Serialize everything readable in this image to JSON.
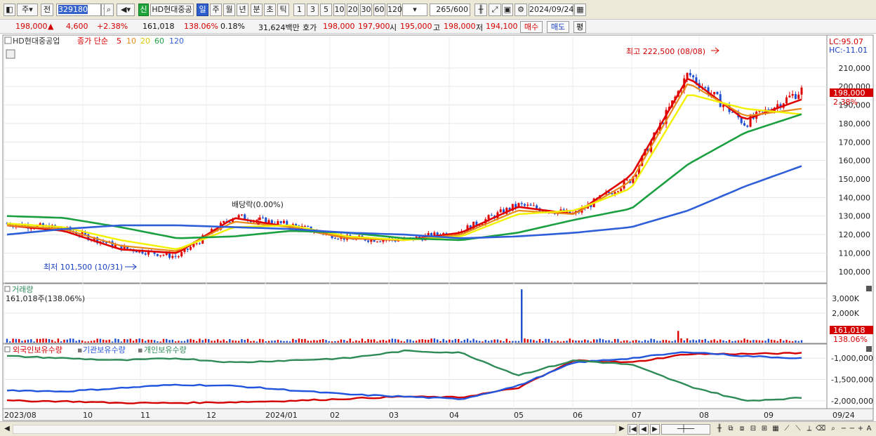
{
  "toolbar": {
    "period_main": "주",
    "view_mode": "전",
    "stock_code": "329180",
    "sin_label": "신",
    "stock_name": "HD현대중공",
    "periods": [
      "일",
      "주",
      "월",
      "년",
      "분",
      "초",
      "틱"
    ],
    "active_period": "일",
    "intervals": [
      "1",
      "3",
      "5",
      "10",
      "20",
      "30",
      "60",
      "120"
    ],
    "count_display": "265",
    "count_total": "/600",
    "date_value": "2024/09/24"
  },
  "quote": {
    "price": "198,000",
    "change": "4,600",
    "change_pct": "+2.38%",
    "volume": "161,018",
    "volume_ratio": "138.06%",
    "turnover_rate": "0.18%",
    "trade_value": "31,624백만",
    "hoga_label": "호가",
    "ask": "198,000",
    "bid": "197,900",
    "open_label": "시",
    "open": "195,000",
    "high_label": "고",
    "high": "198,000",
    "low_label": "저",
    "low": "194,100",
    "buy_label": "매수",
    "sell_label": "매도",
    "eval_label": "평"
  },
  "price_panel": {
    "legend_name": "HD현대중공업",
    "legend_ma_label": "종가 단순",
    "ma_periods": [
      "5",
      "10",
      "20",
      "60",
      "120"
    ],
    "ma_colors": [
      "#e00000",
      "#e88a1a",
      "#f2f200",
      "#1aa040",
      "#2e5fd8"
    ],
    "lc_label": "LC:95.07",
    "hc_label": "HC:-11.01",
    "high_annotation": "최고 222,500 (08/08)",
    "low_annotation": "최저 101,500 (10/31)",
    "dividend_annotation": "배당락(0.00%)",
    "current_price_tag": "198,000",
    "current_pct_tag": "2.38%"
  },
  "volume_panel": {
    "title": "거래량",
    "value_label": "161,018주(138.06%)",
    "tag_value": "161,018",
    "tag_pct": "138.06%"
  },
  "holding_panel": {
    "labels": [
      "외국인보유수량",
      "기관보유수량",
      "개인보유수량"
    ],
    "colors": [
      "#d40000",
      "#2255dd",
      "#2e8b57"
    ]
  },
  "axis": {
    "date_ticks": [
      "2023/08",
      "10",
      "11",
      "12",
      "2024/01",
      "02",
      "03",
      "04",
      "05",
      "06",
      "07",
      "08",
      "09"
    ],
    "last_date": "09/24"
  },
  "chart_data": [
    {
      "type": "candlestick",
      "title": "HD현대중공업",
      "y_ticks": [
        "100,000",
        "110,000",
        "120,000",
        "130,000",
        "140,000",
        "150,000",
        "160,000",
        "170,000",
        "180,000",
        "190,000",
        "200,000",
        "210,000"
      ],
      "ylim": [
        95000,
        227000
      ],
      "x_months": [
        "2023/08",
        "09",
        "10",
        "11",
        "12",
        "2024/01",
        "02",
        "03",
        "04",
        "05",
        "06",
        "07",
        "08",
        "09"
      ],
      "close_monthly": [
        126000,
        123000,
        113000,
        108000,
        130000,
        125000,
        118000,
        117000,
        122000,
        136000,
        131000,
        150000,
        207000,
        180000,
        198000
      ],
      "series": [
        {
          "name": "5",
          "values": [
            125000,
            122000,
            112000,
            110000,
            129000,
            124000,
            118000,
            117000,
            121000,
            135000,
            131000,
            152000,
            205000,
            182000,
            193000
          ]
        },
        {
          "name": "10",
          "values": [
            125000,
            123000,
            114000,
            111000,
            127000,
            124000,
            118000,
            117000,
            120000,
            133000,
            131000,
            149000,
            202000,
            184000,
            188000
          ]
        },
        {
          "name": "20",
          "values": [
            126000,
            124000,
            117000,
            112000,
            124000,
            125000,
            119000,
            117000,
            119000,
            131000,
            133000,
            145000,
            196000,
            188000,
            185000
          ]
        },
        {
          "name": "60",
          "values": [
            130000,
            129000,
            124000,
            118000,
            119000,
            122000,
            121000,
            118000,
            117000,
            121000,
            128000,
            134000,
            158000,
            175000,
            185000
          ]
        },
        {
          "name": "120",
          "values": [
            120000,
            123000,
            125000,
            125000,
            124000,
            123000,
            121000,
            120000,
            118000,
            119000,
            121000,
            124000,
            133000,
            146000,
            157000
          ]
        }
      ],
      "annotations": {
        "high": 222500,
        "low": 101500,
        "current": 198000
      }
    },
    {
      "type": "bar",
      "title": "거래량",
      "y_ticks": [
        "2,000K",
        "3,000K"
      ],
      "ylim": [
        0,
        3700000
      ],
      "spike": 3600000,
      "typical": 180000,
      "last": 161018
    },
    {
      "type": "line",
      "y_ticks": [
        "-1,000,000",
        "-1,500,000",
        "-2,000,000"
      ],
      "ylim": [
        -2150000,
        -700000
      ],
      "series": [
        {
          "name": "외국인보유수량",
          "values": [
            -2000000,
            -2010000,
            -2050000,
            -2050000,
            -2030000,
            -2000000,
            -1950000,
            -1900000,
            -1920000,
            -1700000,
            -1050000,
            -1100000,
            -900000,
            -900000,
            -880000
          ]
        },
        {
          "name": "기관보유수량",
          "values": [
            -1750000,
            -1780000,
            -1700000,
            -1620000,
            -1650000,
            -1750000,
            -1850000,
            -1900000,
            -1960000,
            -1650000,
            -1100000,
            -1000000,
            -850000,
            -950000,
            -1000000
          ]
        },
        {
          "name": "개인보유수량",
          "values": [
            -950000,
            -1000000,
            -1050000,
            -1000000,
            -1100000,
            -1050000,
            -1000000,
            -830000,
            -870000,
            -1400000,
            -1050000,
            -1150000,
            -1650000,
            -2000000,
            -1930000
          ]
        }
      ]
    }
  ]
}
